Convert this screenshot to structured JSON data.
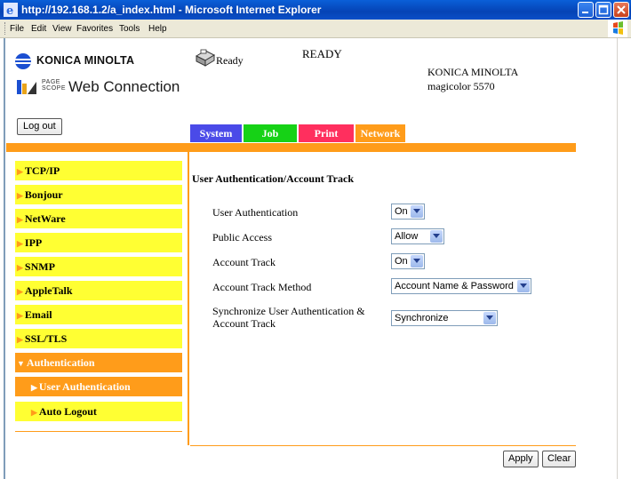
{
  "window": {
    "title": "http://192.168.1.2/a_index.html - Microsoft Internet Explorer"
  },
  "menubar": {
    "items": [
      "File",
      "Edit",
      "View",
      "Favorites",
      "Tools",
      "Help"
    ]
  },
  "header": {
    "brand": "KONICA MINOLTA",
    "pagescope_small": "PAGE SCOPE",
    "web_connection": "Web Connection",
    "status_small": "Ready",
    "status_big": "READY",
    "model_line1": "KONICA MINOLTA",
    "model_line2": "magicolor 5570",
    "logout_label": "Log out"
  },
  "tabs": [
    {
      "label": "System",
      "color": "#4a4ae8"
    },
    {
      "label": "Job",
      "color": "#16d216"
    },
    {
      "label": "Print",
      "color": "#ff2f5e"
    },
    {
      "label": "Network",
      "color": "#ff9c1a"
    }
  ],
  "sidebar": {
    "items": [
      {
        "label": "TCP/IP"
      },
      {
        "label": "Bonjour"
      },
      {
        "label": "NetWare"
      },
      {
        "label": "IPP"
      },
      {
        "label": "SNMP"
      },
      {
        "label": "AppleTalk"
      },
      {
        "label": "Email"
      },
      {
        "label": "SSL/TLS"
      },
      {
        "label": "Authentication",
        "expanded": true
      },
      {
        "label": "User Authentication",
        "sub": true,
        "selected": true
      },
      {
        "label": "Auto Logout",
        "sub": true
      }
    ]
  },
  "main": {
    "title": "User Authentication/Account Track",
    "fields": [
      {
        "label": "User Authentication",
        "value": "On"
      },
      {
        "label": "Public Access",
        "value": "Allow"
      },
      {
        "label": "Account Track",
        "value": "On"
      },
      {
        "label": "Account Track Method",
        "value": "Account Name & Password"
      },
      {
        "label": "Synchronize User Authentication & Account Track",
        "value": "Synchronize"
      }
    ],
    "apply_label": "Apply",
    "clear_label": "Clear"
  },
  "colors": {
    "accent": "#ff9c1a",
    "sidebar_bg": "#ffff33",
    "title_bar": "#0543b5"
  }
}
